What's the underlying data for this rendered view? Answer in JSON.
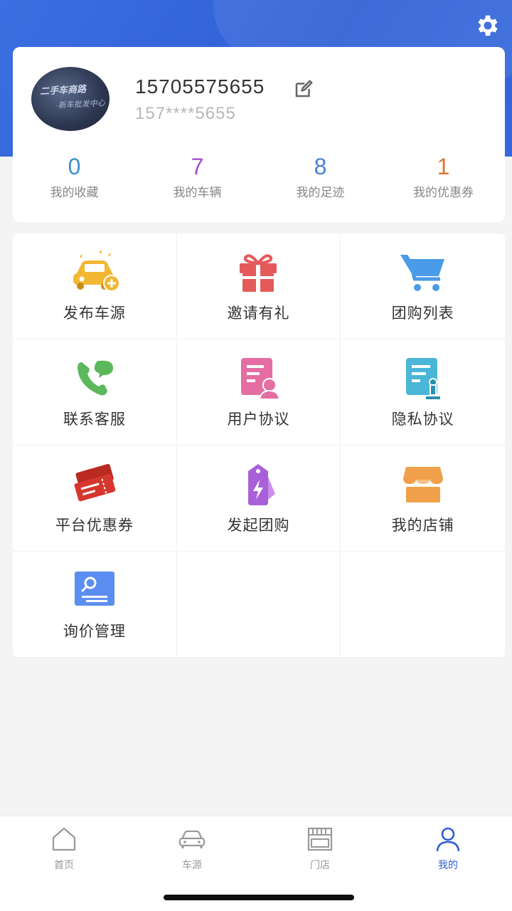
{
  "profile": {
    "phone": "15705575655",
    "phone_masked": "157****5655",
    "avatar_text_1": "二手车商路",
    "avatar_text_2": "·新车批发中心"
  },
  "stats": [
    {
      "value": "0",
      "label": "我的收藏",
      "color": "#3a8fc9"
    },
    {
      "value": "7",
      "label": "我的车辆",
      "color": "#a64fc9"
    },
    {
      "value": "8",
      "label": "我的足迹",
      "color": "#4a7fd6"
    },
    {
      "value": "1",
      "label": "我的优惠券",
      "color": "#e0732e"
    }
  ],
  "menu": [
    {
      "label": "发布车源",
      "icon": "car-plus-icon",
      "color": "#f2b732"
    },
    {
      "label": "邀请有礼",
      "icon": "gift-icon",
      "color": "#e45a5a"
    },
    {
      "label": "团购列表",
      "icon": "shopping-cart-icon",
      "color": "#4a9be8"
    },
    {
      "label": "联系客服",
      "icon": "phone-chat-icon",
      "color": "#5cb85c"
    },
    {
      "label": "用户协议",
      "icon": "user-document-icon",
      "color": "#e46ea3"
    },
    {
      "label": "隐私协议",
      "icon": "privacy-document-icon",
      "color": "#4ab6d8"
    },
    {
      "label": "平台优惠券",
      "icon": "tickets-icon",
      "color": "#d6362e"
    },
    {
      "label": "发起团购",
      "icon": "tag-bolt-icon",
      "color": "#a860d8"
    },
    {
      "label": "我的店铺",
      "icon": "store-icon",
      "color": "#f0a04b"
    },
    {
      "label": "询价管理",
      "icon": "search-card-icon",
      "color": "#5b8ef0"
    }
  ],
  "tabs": [
    {
      "label": "首页",
      "icon": "home-icon"
    },
    {
      "label": "车源",
      "icon": "car-icon"
    },
    {
      "label": "门店",
      "icon": "shop-icon"
    },
    {
      "label": "我的",
      "icon": "user-icon"
    }
  ],
  "colors": {
    "primary": "#2f5fd6",
    "background": "#f4f4f5"
  }
}
